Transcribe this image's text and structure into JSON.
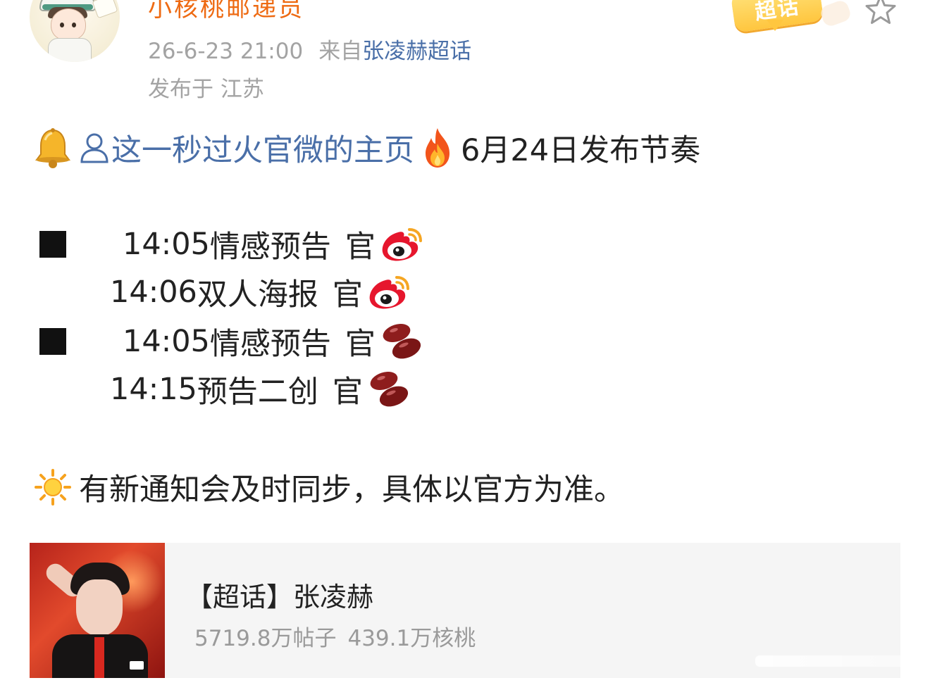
{
  "header": {
    "username": "小核桃邮递员",
    "timestamp": "26-6-23 21:00",
    "from_label": "来自",
    "topic_link": "张凌赫超话",
    "location": "发布于 江苏",
    "badge_label": "超话",
    "icons": [
      "avatar",
      "super-topic-badge",
      "star-icon"
    ]
  },
  "post": {
    "headline": {
      "icons": [
        "bell-icon",
        "person-icon",
        "fire-icon"
      ],
      "link_text": "这一秒过火官微的主页",
      "rest_text": "6月24日发布节奏"
    },
    "schedule": [
      {
        "time": "14:05",
        "event": "情感预告",
        "account": "官",
        "icon": "weibo-logo-icon",
        "bullet": true
      },
      {
        "time": "14:06",
        "event": "双人海报",
        "account": "官",
        "icon": "weibo-logo-icon",
        "bullet": false
      },
      {
        "time": "14:05",
        "event": "情感预告",
        "account": "官",
        "icon": "red-bean-icon",
        "bullet": true
      },
      {
        "time": "14:15",
        "event": "预告二创 ",
        "account": "官",
        "icon": "red-bean-icon",
        "bullet": false
      }
    ],
    "note": {
      "icon": "sun-icon",
      "text": "有新通知会及时同步，具体以官方为准。"
    }
  },
  "card": {
    "title": "【超话】张凌赫",
    "posts": "5719.8万帖子",
    "members": "439.1万核桃"
  },
  "colors": {
    "username": "#ee6a12",
    "link": "#4a6fa8",
    "meta": "#a3a3a3",
    "text": "#222222",
    "card_bg": "#f5f5f5"
  }
}
